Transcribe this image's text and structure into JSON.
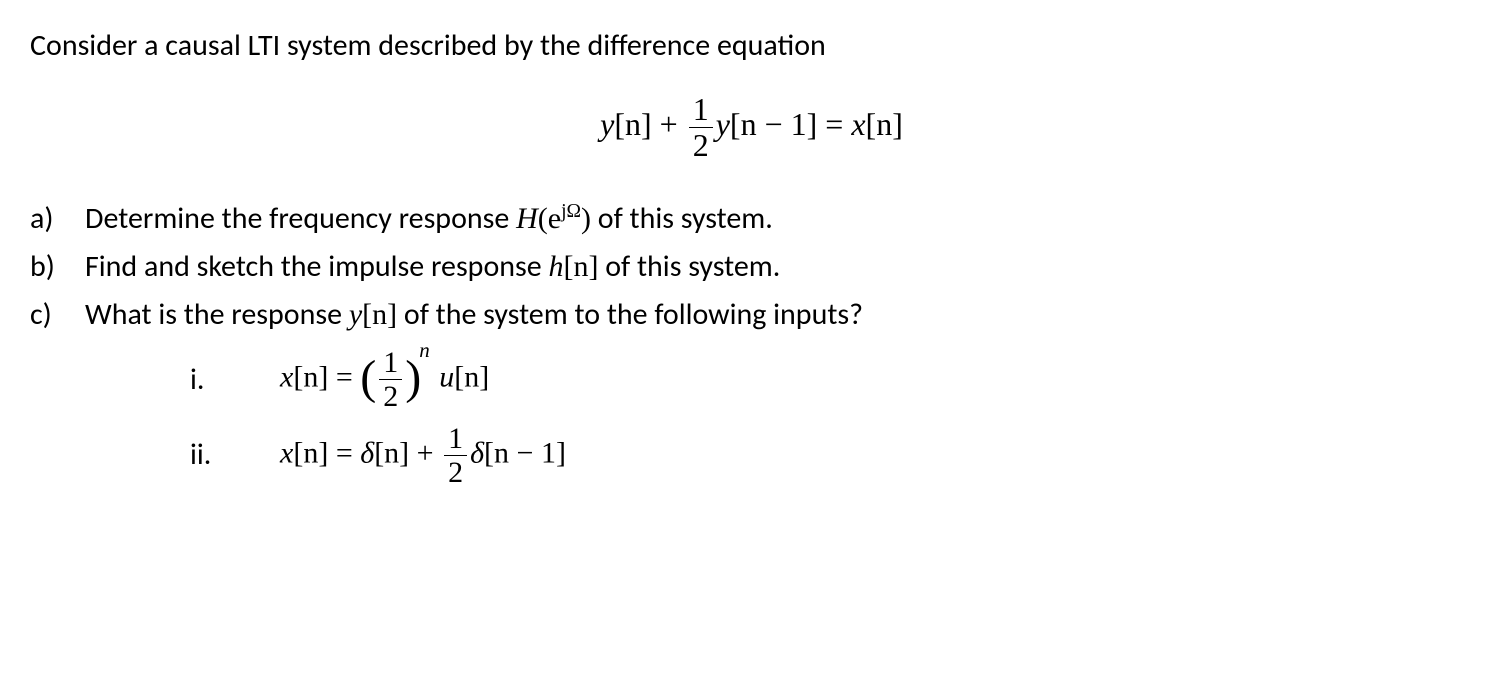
{
  "intro": "Consider a causal LTI system described by the difference equation",
  "main_equation": {
    "lhs1": "y",
    "arg1": "[n]",
    "plus": " + ",
    "frac_num": "1",
    "frac_den": "2",
    "lhs2": "y",
    "arg2": "[n − 1]",
    "eq": " = ",
    "rhs": "x",
    "arg3": "[n]"
  },
  "parts": {
    "a": {
      "marker": "a)",
      "text1": "Determine the frequency response ",
      "H": "H",
      "paren_open": "(",
      "e": "e",
      "exp_j": "jΩ",
      "paren_close": ")",
      "text2": " of this system."
    },
    "b": {
      "marker": "b)",
      "text1": "Find and sketch the impulse response ",
      "h": "h",
      "arg": "[n]",
      "text2": " of this system."
    },
    "c": {
      "marker": "c)",
      "text1": "What is the response ",
      "y": "y",
      "arg": "[n]",
      "text2": " of the system to the following inputs?",
      "sub": {
        "i": {
          "marker": "i.",
          "x": "x",
          "arg1": "[n]",
          "eq": " = ",
          "frac_num": "1",
          "frac_den": "2",
          "exp_n": "n",
          "sp": " ",
          "u": "u",
          "arg2": "[n]"
        },
        "ii": {
          "marker": "ii.",
          "x": "x",
          "arg1": "[n]",
          "eq": " = ",
          "d1": "δ",
          "arg2": "[n]",
          "plus": " + ",
          "frac_num": "1",
          "frac_den": "2",
          "d2": "δ",
          "arg3": "[n − 1]"
        }
      }
    }
  }
}
